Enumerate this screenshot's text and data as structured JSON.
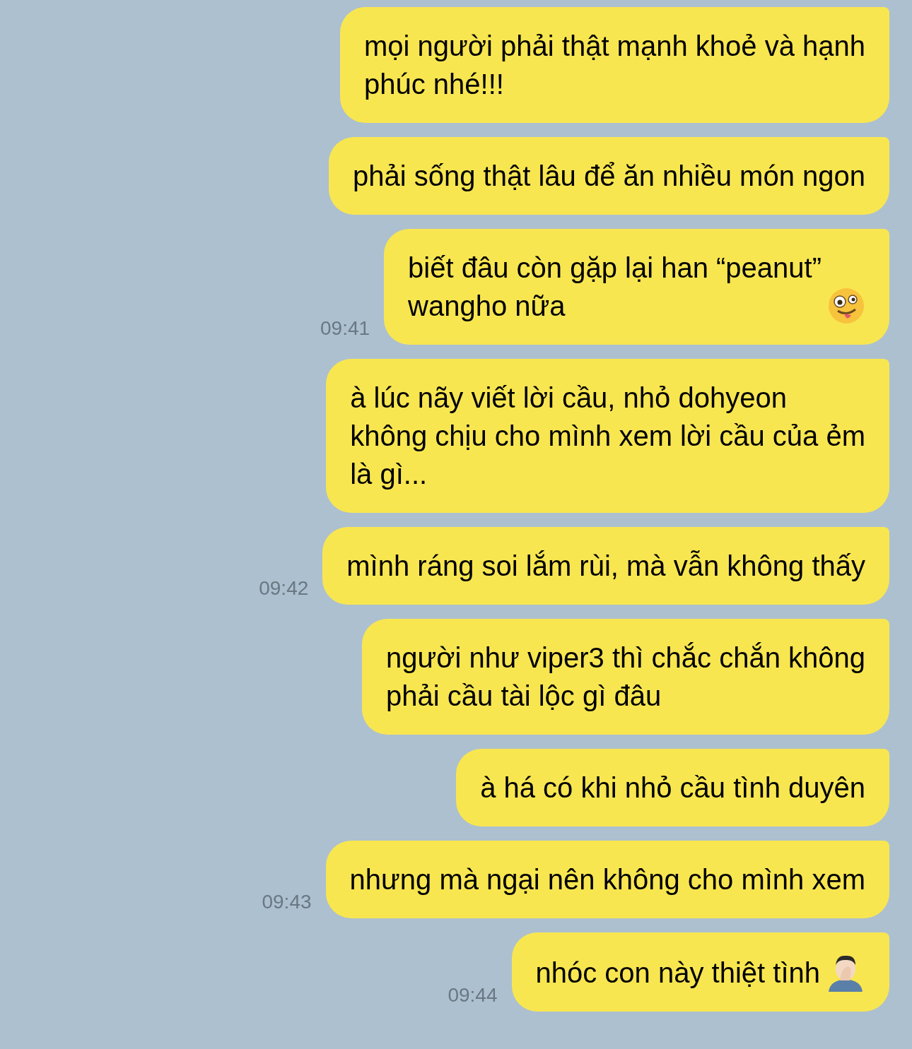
{
  "messages": [
    {
      "text": "mọi người phải thật mạnh khoẻ và hạnh\nphúc nhé!!!"
    },
    {
      "text": "phải sống thật lâu để ăn nhiều món ngon"
    },
    {
      "text": "biết đâu còn gặp lại han “peanut”\nwangho nữa",
      "kind": "zany-face",
      "time": "09:41"
    },
    {
      "text": "à lúc nãy viết lời cầu, nhỏ dohyeon\nkhông chịu cho mình xem lời cầu của ẻm\nlà gì..."
    },
    {
      "text": "mình ráng soi lắm rùi, mà vẫn không thấy",
      "time": "09:42"
    },
    {
      "text": "người như viper3 thì chắc chắn không\nphải cầu tài lộc gì đâu"
    },
    {
      "text": "à há có khi nhỏ cầu tình duyên"
    },
    {
      "text": "nhưng mà ngại nên không cho mình xem",
      "time": "09:43"
    },
    {
      "text": "nhóc con này thiệt tình",
      "kind": "facepalm",
      "time": "09:44"
    }
  ]
}
